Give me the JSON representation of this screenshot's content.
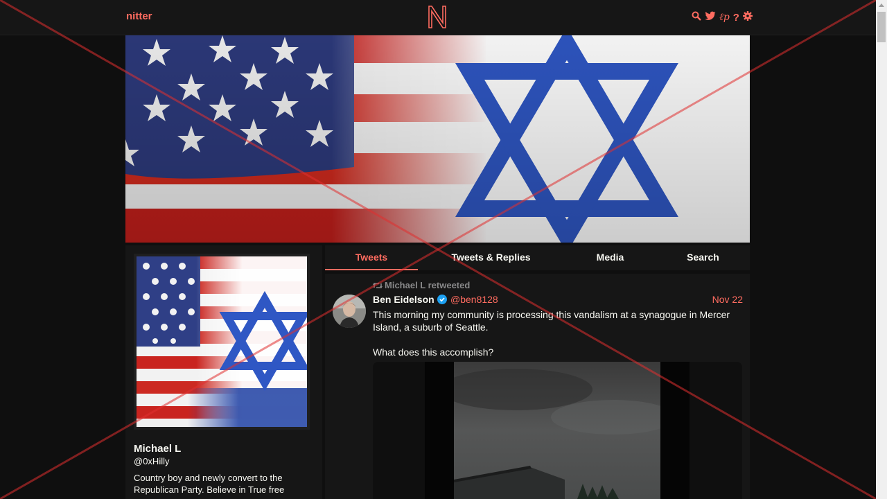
{
  "nav": {
    "brand": "nitter",
    "logo_letter": "N",
    "icons": [
      "search-icon",
      "twitter-bird-icon",
      "rss-icon",
      "help-icon",
      "settings-gear-icon"
    ],
    "rss_glyph": "ℓp",
    "help_glyph": "?"
  },
  "profile": {
    "fullname": "Michael L",
    "username": "@0xHilly",
    "bio": "Country boy and newly convert to the Republican Party. Believe in True free"
  },
  "tabs": [
    {
      "label": "Tweets",
      "active": true
    },
    {
      "label": "Tweets & Replies",
      "active": false
    },
    {
      "label": "Media",
      "active": false
    },
    {
      "label": "Search",
      "active": false
    }
  ],
  "tweet": {
    "retweet_header": "Michael L retweeted",
    "fullname": "Ben Eidelson",
    "verified": true,
    "username": "@ben8128",
    "date": "Nov 22",
    "text_line1": "This morning my community is processing this vandalism at a synagogue in Mercer Island, a suburb of Seattle.",
    "text_line2": "What does this accomplish?"
  },
  "colors": {
    "accent": "#ff6c60",
    "background": "#0f0f0f",
    "panel": "#161616",
    "text": "#f8f8f2",
    "muted": "#888889",
    "verified": "#1da1f2",
    "overlay_red": "#e03030"
  }
}
